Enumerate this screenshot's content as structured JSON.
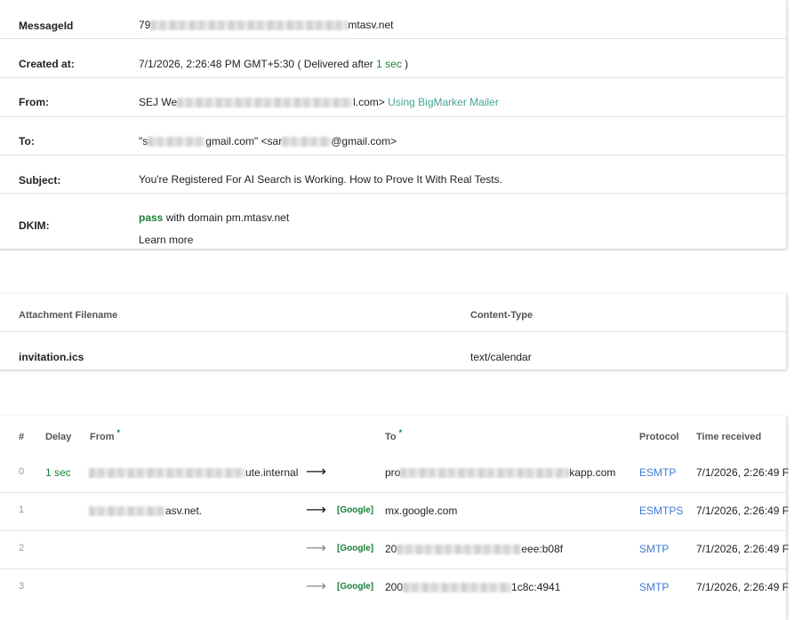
{
  "headers": {
    "message_id": {
      "label": "MessageId",
      "prefix": "79",
      "suffix": "mtasv.net"
    },
    "created_at": {
      "label": "Created at:",
      "text": "7/1/2026, 2:26:48 PM GMT+5:30 ( Delivered after ",
      "delay": "1 sec",
      "close": " )"
    },
    "from": {
      "label": "From:",
      "prefix": "SEJ We",
      "suffix": "l.com>",
      "mailer": "Using BigMarker Mailer"
    },
    "to": {
      "label": "To:",
      "part1": "\"s",
      "part2": "gmail.com\" <sar",
      "part3": "@gmail.com>"
    },
    "subject": {
      "label": "Subject:",
      "text": "You're Registered For AI Search is Working. How to Prove It With Real Tests."
    },
    "dkim": {
      "label": "DKIM:",
      "status": "pass",
      "text": " with domain pm.mtasv.net",
      "learn_more": "Learn more"
    }
  },
  "attachments": {
    "col_filename": "Attachment Filename",
    "col_content_type": "Content-Type",
    "rows": [
      {
        "filename": "invitation.ics",
        "content_type": "text/calendar"
      }
    ]
  },
  "hops": {
    "columns": {
      "num": "#",
      "delay": "Delay",
      "from": "From",
      "from_star": "*",
      "to": "To",
      "to_star": "*",
      "protocol": "Protocol",
      "time": "Time received"
    },
    "rows": [
      {
        "num": "0",
        "delay": "1 sec",
        "from_suffix": "ute.internal",
        "arrow": "⟶",
        "tag": "",
        "to_prefix": "pro",
        "to_suffix": "kapp.com",
        "protocol": "ESMTP",
        "time": "7/1/2026, 2:26:49 F"
      },
      {
        "num": "1",
        "delay": "",
        "from_suffix": "asv.net.",
        "arrow": "⟶",
        "tag": "[Google]",
        "to_prefix": "mx.google.com",
        "to_suffix": "",
        "protocol": "ESMTPS",
        "time": "7/1/2026, 2:26:49 F"
      },
      {
        "num": "2",
        "delay": "",
        "from_suffix": "",
        "arrow": "⟶",
        "tag": "[Google]",
        "to_prefix": "20",
        "to_suffix": "eee:b08f",
        "protocol": "SMTP",
        "time": "7/1/2026, 2:26:49 F"
      },
      {
        "num": "3",
        "delay": "",
        "from_suffix": "",
        "arrow": "⟶",
        "tag": "[Google]",
        "to_prefix": "200",
        "to_suffix": "1c8c:4941",
        "protocol": "SMTP",
        "time": "7/1/2026, 2:26:49 F"
      }
    ]
  },
  "colors": {
    "green": "#188038",
    "teal": "#41a595",
    "blue": "#3d7bd8"
  }
}
